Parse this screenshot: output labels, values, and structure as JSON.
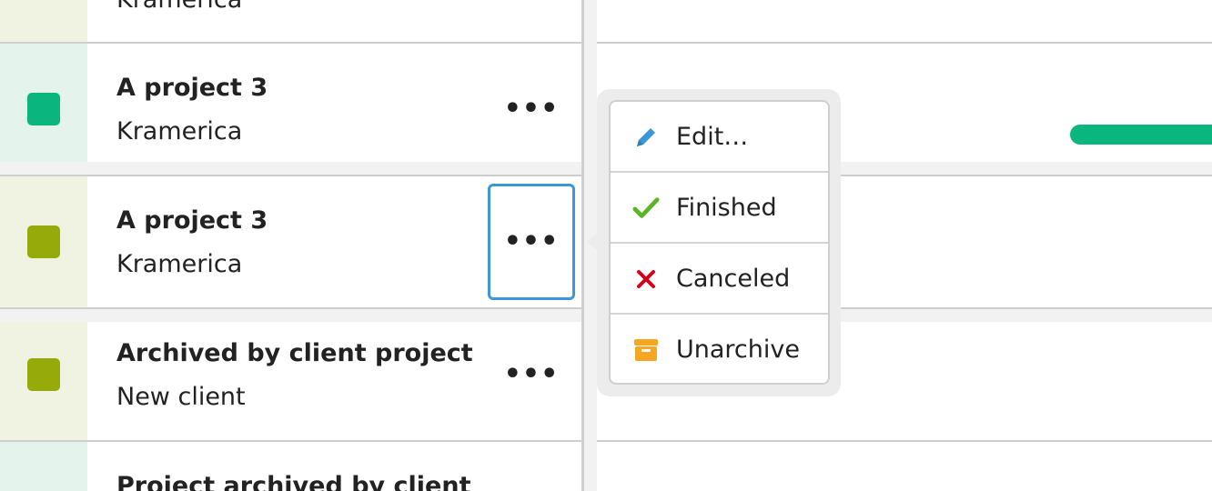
{
  "colors": {
    "accent_focus": "#3b97d6",
    "bar_green": "#0bb57e",
    "stripe_green": "#e4f4ec",
    "stripe_olive": "#f0f3e1",
    "swatch_green": "#0bb57e",
    "swatch_olive": "#96ab0a"
  },
  "rows": [
    {
      "name": "",
      "client": "Kramerica"
    },
    {
      "name": "A project 3",
      "client": "Kramerica",
      "more": "•••"
    },
    {
      "name": "A project 3",
      "client": "Kramerica",
      "more": "•••"
    },
    {
      "name": "Archived by client project",
      "client": "New client",
      "more": "•••"
    },
    {
      "name": "Project archived by client",
      "client": ""
    }
  ],
  "menu": {
    "items": [
      {
        "label": "Edit…",
        "icon": "pencil-icon"
      },
      {
        "label": "Finished",
        "icon": "check-icon"
      },
      {
        "label": "Canceled",
        "icon": "x-icon"
      },
      {
        "label": "Unarchive",
        "icon": "archive-box-icon"
      }
    ]
  },
  "timeline": {
    "progress_bar_color": "#0bb57e"
  }
}
